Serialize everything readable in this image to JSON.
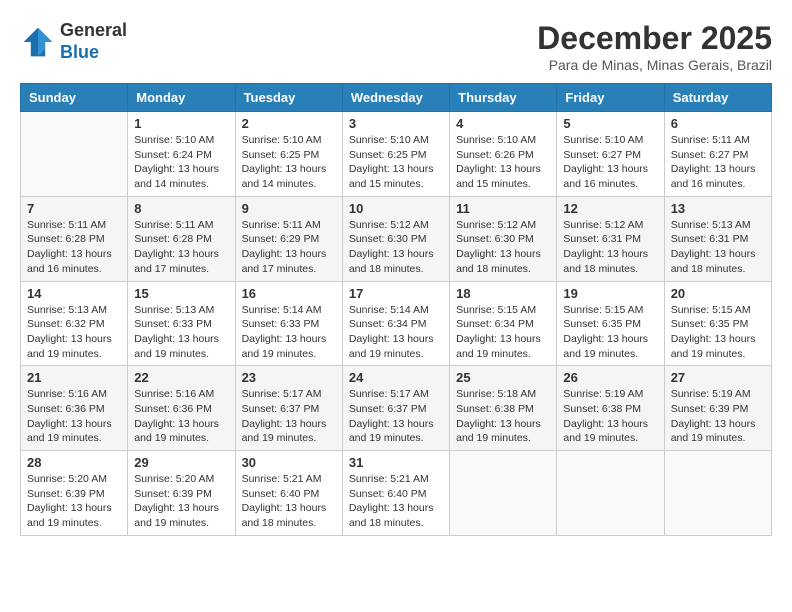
{
  "header": {
    "logo_line1": "General",
    "logo_line2": "Blue",
    "month": "December 2025",
    "location": "Para de Minas, Minas Gerais, Brazil"
  },
  "weekdays": [
    "Sunday",
    "Monday",
    "Tuesday",
    "Wednesday",
    "Thursday",
    "Friday",
    "Saturday"
  ],
  "weeks": [
    [
      {
        "day": "",
        "sunrise": "",
        "sunset": "",
        "daylight": ""
      },
      {
        "day": "1",
        "sunrise": "Sunrise: 5:10 AM",
        "sunset": "Sunset: 6:24 PM",
        "daylight": "Daylight: 13 hours and 14 minutes."
      },
      {
        "day": "2",
        "sunrise": "Sunrise: 5:10 AM",
        "sunset": "Sunset: 6:25 PM",
        "daylight": "Daylight: 13 hours and 14 minutes."
      },
      {
        "day": "3",
        "sunrise": "Sunrise: 5:10 AM",
        "sunset": "Sunset: 6:25 PM",
        "daylight": "Daylight: 13 hours and 15 minutes."
      },
      {
        "day": "4",
        "sunrise": "Sunrise: 5:10 AM",
        "sunset": "Sunset: 6:26 PM",
        "daylight": "Daylight: 13 hours and 15 minutes."
      },
      {
        "day": "5",
        "sunrise": "Sunrise: 5:10 AM",
        "sunset": "Sunset: 6:27 PM",
        "daylight": "Daylight: 13 hours and 16 minutes."
      },
      {
        "day": "6",
        "sunrise": "Sunrise: 5:11 AM",
        "sunset": "Sunset: 6:27 PM",
        "daylight": "Daylight: 13 hours and 16 minutes."
      }
    ],
    [
      {
        "day": "7",
        "sunrise": "Sunrise: 5:11 AM",
        "sunset": "Sunset: 6:28 PM",
        "daylight": "Daylight: 13 hours and 16 minutes."
      },
      {
        "day": "8",
        "sunrise": "Sunrise: 5:11 AM",
        "sunset": "Sunset: 6:28 PM",
        "daylight": "Daylight: 13 hours and 17 minutes."
      },
      {
        "day": "9",
        "sunrise": "Sunrise: 5:11 AM",
        "sunset": "Sunset: 6:29 PM",
        "daylight": "Daylight: 13 hours and 17 minutes."
      },
      {
        "day": "10",
        "sunrise": "Sunrise: 5:12 AM",
        "sunset": "Sunset: 6:30 PM",
        "daylight": "Daylight: 13 hours and 18 minutes."
      },
      {
        "day": "11",
        "sunrise": "Sunrise: 5:12 AM",
        "sunset": "Sunset: 6:30 PM",
        "daylight": "Daylight: 13 hours and 18 minutes."
      },
      {
        "day": "12",
        "sunrise": "Sunrise: 5:12 AM",
        "sunset": "Sunset: 6:31 PM",
        "daylight": "Daylight: 13 hours and 18 minutes."
      },
      {
        "day": "13",
        "sunrise": "Sunrise: 5:13 AM",
        "sunset": "Sunset: 6:31 PM",
        "daylight": "Daylight: 13 hours and 18 minutes."
      }
    ],
    [
      {
        "day": "14",
        "sunrise": "Sunrise: 5:13 AM",
        "sunset": "Sunset: 6:32 PM",
        "daylight": "Daylight: 13 hours and 19 minutes."
      },
      {
        "day": "15",
        "sunrise": "Sunrise: 5:13 AM",
        "sunset": "Sunset: 6:33 PM",
        "daylight": "Daylight: 13 hours and 19 minutes."
      },
      {
        "day": "16",
        "sunrise": "Sunrise: 5:14 AM",
        "sunset": "Sunset: 6:33 PM",
        "daylight": "Daylight: 13 hours and 19 minutes."
      },
      {
        "day": "17",
        "sunrise": "Sunrise: 5:14 AM",
        "sunset": "Sunset: 6:34 PM",
        "daylight": "Daylight: 13 hours and 19 minutes."
      },
      {
        "day": "18",
        "sunrise": "Sunrise: 5:15 AM",
        "sunset": "Sunset: 6:34 PM",
        "daylight": "Daylight: 13 hours and 19 minutes."
      },
      {
        "day": "19",
        "sunrise": "Sunrise: 5:15 AM",
        "sunset": "Sunset: 6:35 PM",
        "daylight": "Daylight: 13 hours and 19 minutes."
      },
      {
        "day": "20",
        "sunrise": "Sunrise: 5:15 AM",
        "sunset": "Sunset: 6:35 PM",
        "daylight": "Daylight: 13 hours and 19 minutes."
      }
    ],
    [
      {
        "day": "21",
        "sunrise": "Sunrise: 5:16 AM",
        "sunset": "Sunset: 6:36 PM",
        "daylight": "Daylight: 13 hours and 19 minutes."
      },
      {
        "day": "22",
        "sunrise": "Sunrise: 5:16 AM",
        "sunset": "Sunset: 6:36 PM",
        "daylight": "Daylight: 13 hours and 19 minutes."
      },
      {
        "day": "23",
        "sunrise": "Sunrise: 5:17 AM",
        "sunset": "Sunset: 6:37 PM",
        "daylight": "Daylight: 13 hours and 19 minutes."
      },
      {
        "day": "24",
        "sunrise": "Sunrise: 5:17 AM",
        "sunset": "Sunset: 6:37 PM",
        "daylight": "Daylight: 13 hours and 19 minutes."
      },
      {
        "day": "25",
        "sunrise": "Sunrise: 5:18 AM",
        "sunset": "Sunset: 6:38 PM",
        "daylight": "Daylight: 13 hours and 19 minutes."
      },
      {
        "day": "26",
        "sunrise": "Sunrise: 5:19 AM",
        "sunset": "Sunset: 6:38 PM",
        "daylight": "Daylight: 13 hours and 19 minutes."
      },
      {
        "day": "27",
        "sunrise": "Sunrise: 5:19 AM",
        "sunset": "Sunset: 6:39 PM",
        "daylight": "Daylight: 13 hours and 19 minutes."
      }
    ],
    [
      {
        "day": "28",
        "sunrise": "Sunrise: 5:20 AM",
        "sunset": "Sunset: 6:39 PM",
        "daylight": "Daylight: 13 hours and 19 minutes."
      },
      {
        "day": "29",
        "sunrise": "Sunrise: 5:20 AM",
        "sunset": "Sunset: 6:39 PM",
        "daylight": "Daylight: 13 hours and 19 minutes."
      },
      {
        "day": "30",
        "sunrise": "Sunrise: 5:21 AM",
        "sunset": "Sunset: 6:40 PM",
        "daylight": "Daylight: 13 hours and 18 minutes."
      },
      {
        "day": "31",
        "sunrise": "Sunrise: 5:21 AM",
        "sunset": "Sunset: 6:40 PM",
        "daylight": "Daylight: 13 hours and 18 minutes."
      },
      {
        "day": "",
        "sunrise": "",
        "sunset": "",
        "daylight": ""
      },
      {
        "day": "",
        "sunrise": "",
        "sunset": "",
        "daylight": ""
      },
      {
        "day": "",
        "sunrise": "",
        "sunset": "",
        "daylight": ""
      }
    ]
  ]
}
